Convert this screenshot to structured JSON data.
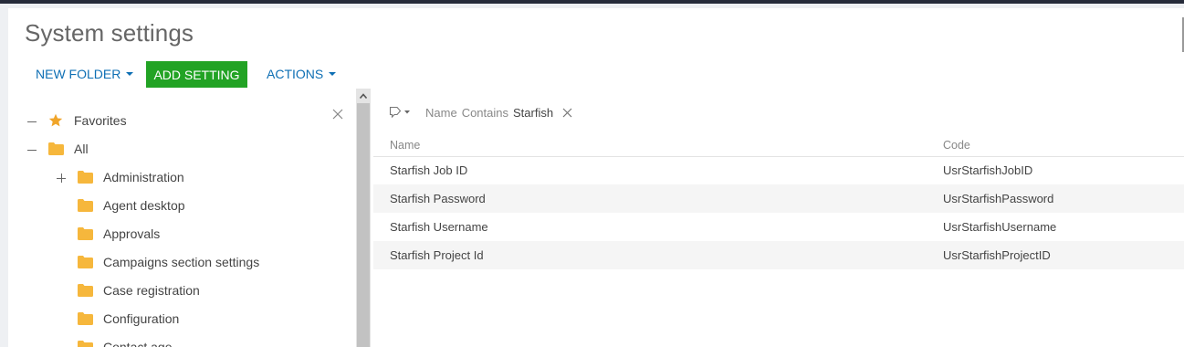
{
  "page": {
    "title": "System settings"
  },
  "toolbar": {
    "new_folder": "NEW FOLDER",
    "add_setting": "ADD SETTING",
    "actions": "ACTIONS"
  },
  "tree": {
    "favorites": "Favorites",
    "all": "All",
    "items": [
      "Administration",
      "Agent desktop",
      "Approvals",
      "Campaigns section settings",
      "Case registration",
      "Configuration",
      "Contact age"
    ]
  },
  "filter": {
    "field": "Name",
    "operator": "Contains",
    "value": "Starfish"
  },
  "grid": {
    "columns": [
      "Name",
      "Code"
    ],
    "rows": [
      {
        "name": "Starfish Job ID",
        "code": "UsrStarfishJobID"
      },
      {
        "name": "Starfish Password",
        "code": "UsrStarfishPassword"
      },
      {
        "name": "Starfish Username",
        "code": "UsrStarfishUsername"
      },
      {
        "name": "Starfish Project Id",
        "code": "UsrStarfishProjectID"
      }
    ]
  },
  "colors": {
    "accent": "#0e6fb4",
    "add_button": "#22a324",
    "folder": "#f6b73c",
    "star": "#f0a52a"
  }
}
